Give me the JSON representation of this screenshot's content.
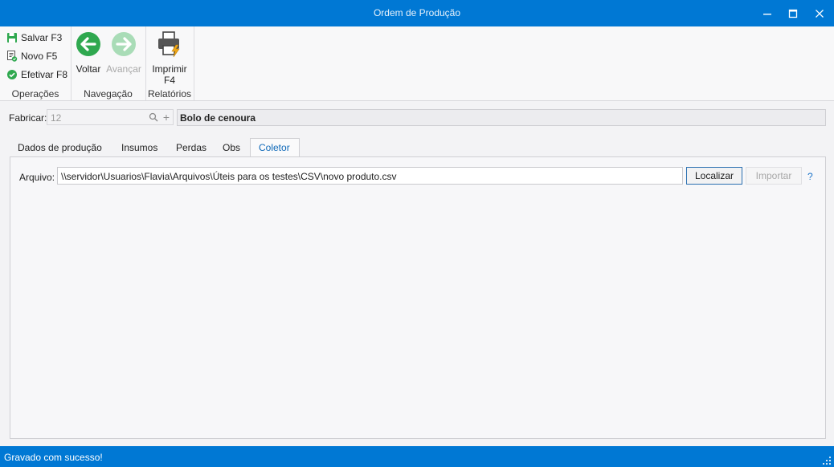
{
  "window": {
    "title": "Ordem de Produção"
  },
  "ribbon": {
    "operacoes": {
      "label": "Operações",
      "salvar": "Salvar F3",
      "novo": "Novo F5",
      "efetivar": "Efetivar F8"
    },
    "navegacao": {
      "label": "Navegação",
      "voltar": "Voltar",
      "avancar": "Avançar"
    },
    "relatorios": {
      "label": "Relatórios",
      "imprimir": "Imprimir",
      "imprimir_key": "F4"
    }
  },
  "fabricar": {
    "label": "Fabricar:",
    "code": "12",
    "name": "Bolo de cenoura"
  },
  "tabs": [
    {
      "label": "Dados de produção"
    },
    {
      "label": "Insumos"
    },
    {
      "label": "Perdas"
    },
    {
      "label": "Obs"
    },
    {
      "label": "Coletor",
      "active": true
    }
  ],
  "coletor": {
    "arquivo_label": "Arquivo:",
    "arquivo_value": "\\\\servidor\\Usuarios\\Flavia\\Arquivos\\Úteis para os testes\\CSV\\novo produto.csv",
    "localizar": "Localizar",
    "importar": "Importar",
    "help": "?"
  },
  "status": {
    "message": "Gravado com sucesso!"
  },
  "colors": {
    "accent": "#0078d4",
    "success": "#2fa84f",
    "active_tab": "#0e68b8"
  }
}
